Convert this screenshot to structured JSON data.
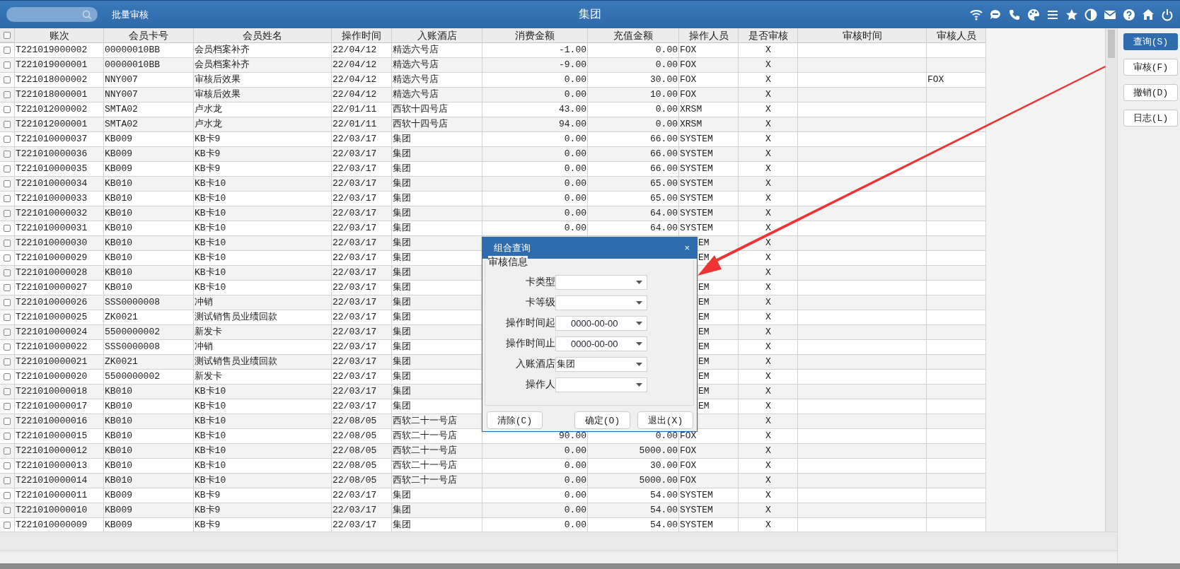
{
  "top_bar": {
    "section": "批量审核",
    "title": "集团"
  },
  "table": {
    "select_all_checked": false,
    "columns": [
      "账次",
      "会员卡号",
      "会员姓名",
      "操作时间",
      "入账酒店",
      "消费金额",
      "充值金额",
      "操作人员",
      "是否审核",
      "审核时间",
      "审核人员"
    ],
    "rows": [
      {
        "checked": false,
        "overlaid": false,
        "cells": [
          "T221019000002",
          "00000010BB",
          "会员档案补齐",
          "22/04/12",
          "精选六号店",
          "-1.00",
          "0.00",
          "FOX",
          "X",
          null,
          null
        ]
      },
      {
        "checked": false,
        "overlaid": false,
        "cells": [
          "T221019000001",
          "00000010BB",
          "会员档案补齐",
          "22/04/12",
          "精选六号店",
          "-9.00",
          "0.00",
          "FOX",
          "X",
          null,
          null
        ]
      },
      {
        "checked": false,
        "overlaid": false,
        "cells": [
          "T221018000002",
          "NNY007",
          "审核后效果",
          "22/04/12",
          "精选六号店",
          "0.00",
          "30.00",
          "FOX",
          "X",
          null,
          "FOX"
        ]
      },
      {
        "checked": false,
        "overlaid": false,
        "cells": [
          "T221018000001",
          "NNY007",
          "审核后效果",
          "22/04/12",
          "精选六号店",
          "0.00",
          "10.00",
          "FOX",
          "X",
          null,
          null
        ]
      },
      {
        "checked": false,
        "overlaid": false,
        "cells": [
          "T221012000002",
          "SMTA02",
          "卢水龙",
          "22/01/11",
          "西软十四号店",
          "43.00",
          "0.00",
          "XRSM",
          "X",
          null,
          null
        ]
      },
      {
        "checked": false,
        "overlaid": false,
        "cells": [
          "T221012000001",
          "SMTA02",
          "卢水龙",
          "22/01/11",
          "西软十四号店",
          "94.00",
          "0.00",
          "XRSM",
          "X",
          null,
          null
        ]
      },
      {
        "checked": false,
        "overlaid": false,
        "cells": [
          "T221010000037",
          "KB009",
          "KB卡9",
          "22/03/17",
          "集团",
          "0.00",
          "66.00",
          "SYSTEM",
          "X",
          null,
          null
        ]
      },
      {
        "checked": false,
        "overlaid": false,
        "cells": [
          "T221010000036",
          "KB009",
          "KB卡9",
          "22/03/17",
          "集团",
          "0.00",
          "66.00",
          "SYSTEM",
          "X",
          null,
          null
        ]
      },
      {
        "checked": false,
        "overlaid": false,
        "cells": [
          "T221010000035",
          "KB009",
          "KB卡9",
          "22/03/17",
          "集团",
          "0.00",
          "66.00",
          "SYSTEM",
          "X",
          null,
          null
        ]
      },
      {
        "checked": false,
        "overlaid": false,
        "cells": [
          "T221010000034",
          "KB010",
          "KB卡10",
          "22/03/17",
          "集团",
          "0.00",
          "65.00",
          "SYSTEM",
          "X",
          null,
          null
        ]
      },
      {
        "checked": false,
        "overlaid": false,
        "cells": [
          "T221010000033",
          "KB010",
          "KB卡10",
          "22/03/17",
          "集团",
          "0.00",
          "65.00",
          "SYSTEM",
          "X",
          null,
          null
        ]
      },
      {
        "checked": false,
        "overlaid": false,
        "cells": [
          "T221010000032",
          "KB010",
          "KB卡10",
          "22/03/17",
          "集团",
          "0.00",
          "64.00",
          "SYSTEM",
          "X",
          null,
          null
        ]
      },
      {
        "checked": false,
        "overlaid": false,
        "cells": [
          "T221010000031",
          "KB010",
          "KB卡10",
          "22/03/17",
          "集团",
          "0.00",
          "64.00",
          "SYSTEM",
          "X",
          null,
          null
        ]
      },
      {
        "checked": false,
        "overlaid": true,
        "cells": [
          "T221010000030",
          "KB010",
          "KB卡10",
          "22/03/17",
          "集团",
          null,
          null,
          "EM",
          "X",
          null,
          null
        ]
      },
      {
        "checked": false,
        "overlaid": true,
        "cells": [
          "T221010000029",
          "KB010",
          "KB卡10",
          "22/03/17",
          "集团",
          null,
          null,
          "EM",
          "X",
          null,
          null
        ]
      },
      {
        "checked": false,
        "cells": [
          "T221010000028",
          "KB010",
          "KB卡10",
          "22/03/17",
          "集团",
          null,
          null,
          null,
          "X",
          null,
          null
        ]
      },
      {
        "checked": false,
        "overlaid": true,
        "cells": [
          "T221010000027",
          "KB010",
          "KB卡10",
          "22/03/17",
          "集团",
          null,
          null,
          "EM",
          "X",
          null,
          null
        ]
      },
      {
        "checked": false,
        "overlaid": true,
        "cells": [
          "T221010000026",
          "SSS0000008",
          "冲销",
          "22/03/17",
          "集团",
          null,
          null,
          "EM",
          "X",
          null,
          null
        ]
      },
      {
        "checked": false,
        "overlaid": true,
        "cells": [
          "T221010000025",
          "ZK0021",
          "测试销售员业绩回款",
          "22/03/17",
          "集团",
          null,
          null,
          "EM",
          "X",
          null,
          null
        ]
      },
      {
        "checked": false,
        "overlaid": true,
        "cells": [
          "T221010000024",
          "5500000002",
          "新发卡",
          "22/03/17",
          "集团",
          null,
          null,
          "EM",
          "X",
          null,
          null
        ]
      },
      {
        "checked": false,
        "overlaid": true,
        "cells": [
          "T221010000022",
          "SSS0000008",
          "冲销",
          "22/03/17",
          "集团",
          null,
          null,
          "EM",
          "X",
          null,
          null
        ]
      },
      {
        "checked": false,
        "overlaid": true,
        "cells": [
          "T221010000021",
          "ZK0021",
          "测试销售员业绩回款",
          "22/03/17",
          "集团",
          null,
          null,
          "EM",
          "X",
          null,
          null
        ]
      },
      {
        "checked": false,
        "overlaid": true,
        "cells": [
          "T221010000020",
          "5500000002",
          "新发卡",
          "22/03/17",
          "集团",
          null,
          null,
          "EM",
          "X",
          null,
          null
        ]
      },
      {
        "checked": false,
        "overlaid": true,
        "cells": [
          "T221010000018",
          "KB010",
          "KB卡10",
          "22/03/17",
          "集团",
          null,
          null,
          "EM",
          "X",
          null,
          null
        ]
      },
      {
        "checked": false,
        "overlaid": true,
        "cells": [
          "T221010000017",
          "KB010",
          "KB卡10",
          "22/03/17",
          "集团",
          null,
          null,
          "EM",
          "X",
          null,
          null
        ]
      },
      {
        "checked": false,
        "cells": [
          "T221010000016",
          "KB010",
          "KB卡10",
          "22/08/05",
          "西软二十一号店",
          null,
          null,
          null,
          "X",
          null,
          null
        ]
      },
      {
        "checked": false,
        "overlaid": false,
        "cells": [
          "T221010000015",
          "KB010",
          "KB卡10",
          "22/08/05",
          "西软二十一号店",
          "90.00",
          "0.00",
          "FOX",
          "X",
          null,
          null
        ]
      },
      {
        "checked": false,
        "overlaid": false,
        "cells": [
          "T221010000012",
          "KB010",
          "KB卡10",
          "22/08/05",
          "西软二十一号店",
          "0.00",
          "5000.00",
          "FOX",
          "X",
          null,
          null
        ]
      },
      {
        "checked": false,
        "overlaid": false,
        "cells": [
          "T221010000013",
          "KB010",
          "KB卡10",
          "22/08/05",
          "西软二十一号店",
          "0.00",
          "30.00",
          "FOX",
          "X",
          null,
          null
        ]
      },
      {
        "checked": false,
        "overlaid": false,
        "cells": [
          "T221010000014",
          "KB010",
          "KB卡10",
          "22/08/05",
          "西软二十一号店",
          "0.00",
          "5000.00",
          "FOX",
          "X",
          null,
          null
        ]
      },
      {
        "checked": false,
        "overlaid": false,
        "cells": [
          "T221010000011",
          "KB009",
          "KB卡9",
          "22/03/17",
          "集团",
          "0.00",
          "54.00",
          "SYSTEM",
          "X",
          null,
          null
        ]
      },
      {
        "checked": false,
        "overlaid": false,
        "cells": [
          "T221010000010",
          "KB009",
          "KB卡9",
          "22/03/17",
          "集团",
          "0.00",
          "54.00",
          "SYSTEM",
          "X",
          null,
          null
        ]
      },
      {
        "checked": false,
        "overlaid": false,
        "cells": [
          "T221010000009",
          "KB009",
          "KB卡9",
          "22/03/17",
          "集团",
          "0.00",
          "54.00",
          "SYSTEM",
          "X",
          null,
          null
        ]
      }
    ]
  },
  "side_buttons": [
    {
      "label": "查询(S)",
      "selected": true
    },
    {
      "label": "审核(F)",
      "selected": false
    },
    {
      "label": "撤销(D)",
      "selected": false
    },
    {
      "label": "日志(L)",
      "selected": false
    }
  ],
  "dialog": {
    "title": "组合查询",
    "close": "×",
    "group": "审核信息",
    "fields": [
      {
        "label": "卡类型"
      },
      {
        "label": "卡等级"
      },
      {
        "label": "操作时间起",
        "value": "0000-00-00",
        "kind": "date"
      },
      {
        "label": "操作时间止",
        "value": "0000-00-00",
        "kind": "date"
      },
      {
        "label": "入账酒店",
        "value": "集团",
        "kind": "text"
      },
      {
        "label": "操作人"
      }
    ],
    "buttons": [
      "清除(C)",
      "确定(O)",
      "退出(X)"
    ]
  }
}
